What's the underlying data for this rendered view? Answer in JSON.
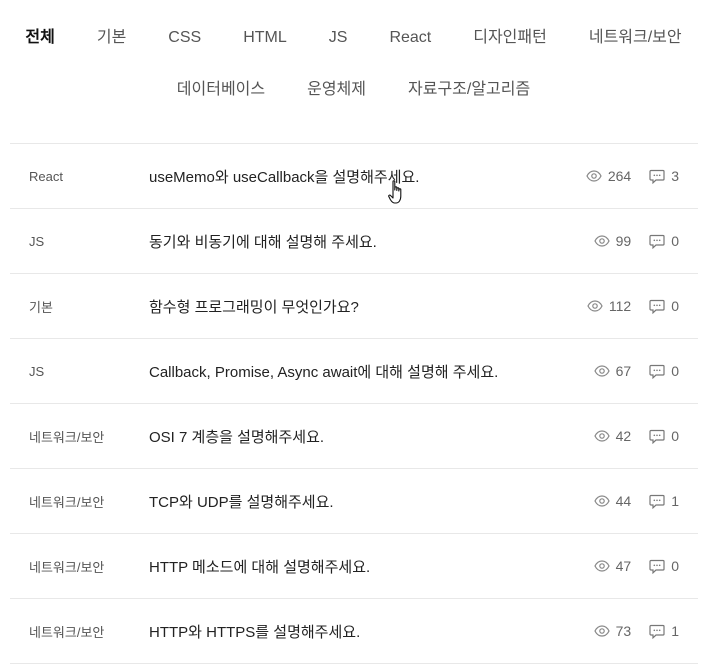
{
  "tabs": {
    "row1": [
      {
        "label": "전체",
        "active": true
      },
      {
        "label": "기본"
      },
      {
        "label": "CSS"
      },
      {
        "label": "HTML"
      },
      {
        "label": "JS"
      },
      {
        "label": "React"
      },
      {
        "label": "디자인패턴"
      },
      {
        "label": "네트워크/보안"
      }
    ],
    "row2": [
      {
        "label": "데이터베이스"
      },
      {
        "label": "운영체제"
      },
      {
        "label": "자료구조/알고리즘"
      }
    ]
  },
  "questions": [
    {
      "category": "React",
      "title": "useMemo와 useCallback을 설명해주세요.",
      "views": "264",
      "comments": "3"
    },
    {
      "category": "JS",
      "title": "동기와 비동기에 대해 설명해 주세요.",
      "views": "99",
      "comments": "0"
    },
    {
      "category": "기본",
      "title": "함수형 프로그래밍이 무엇인가요?",
      "views": "112",
      "comments": "0"
    },
    {
      "category": "JS",
      "title": "Callback, Promise, Async await에 대해 설명해 주세요.",
      "views": "67",
      "comments": "0"
    },
    {
      "category": "네트워크/보안",
      "title": "OSI 7 계층을 설명해주세요.",
      "views": "42",
      "comments": "0"
    },
    {
      "category": "네트워크/보안",
      "title": "TCP와 UDP를 설명해주세요.",
      "views": "44",
      "comments": "1"
    },
    {
      "category": "네트워크/보안",
      "title": "HTTP 메소드에 대해 설명해주세요.",
      "views": "47",
      "comments": "0"
    },
    {
      "category": "네트워크/보안",
      "title": "HTTP와 HTTPS를 설명해주세요.",
      "views": "73",
      "comments": "1"
    }
  ],
  "icons": {
    "views": "eye-icon",
    "comments": "comment-icon",
    "cursor": "hand-pointer-icon"
  },
  "colors": {
    "text": "#222222",
    "muted": "#666666",
    "divider": "#e8e8e8"
  }
}
